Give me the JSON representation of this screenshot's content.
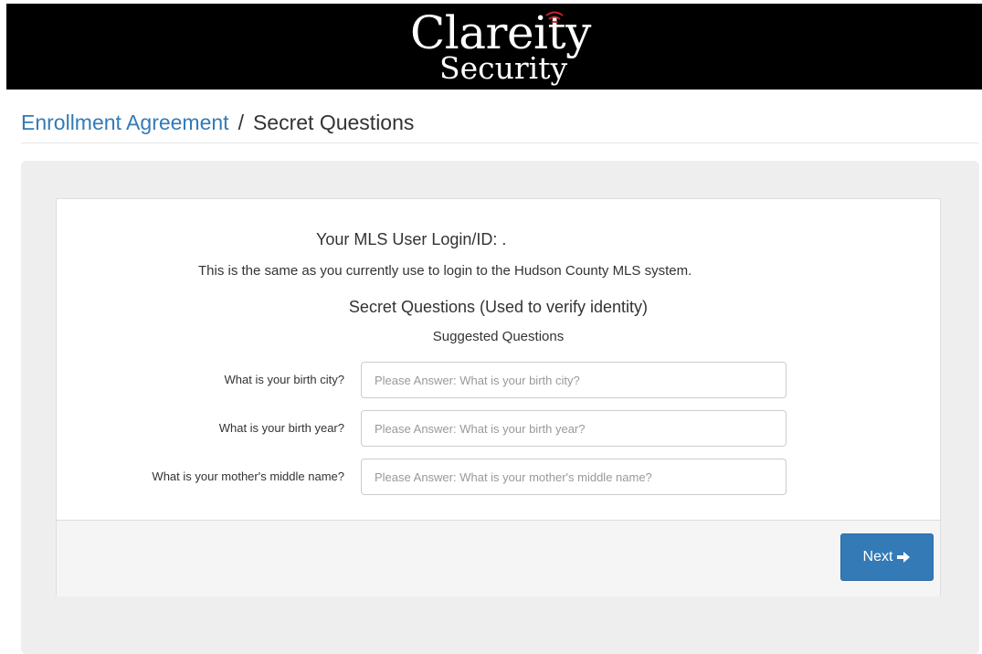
{
  "header": {
    "logo_word1": "Clareity",
    "logo_word2": "Security",
    "logo_accent_color": "#c0262d"
  },
  "breadcrumb": {
    "link": "Enrollment Agreement",
    "separator": "/",
    "current": "Secret Questions"
  },
  "form": {
    "login_label": "Your MLS User Login/ID: .",
    "login_note": "This is the same as you currently use to login to the Hudson County MLS system.",
    "section_title": "Secret Questions (Used to verify identity)",
    "section_subtitle": "Suggested Questions",
    "questions": [
      {
        "label": "What is your birth city?",
        "value": "",
        "placeholder": "Please Answer: What is your birth city?"
      },
      {
        "label": "What is your birth year?",
        "value": "",
        "placeholder": "Please Answer: What is your birth year?"
      },
      {
        "label": "What is your mother's middle name?",
        "value": "",
        "placeholder": "Please Answer: What is your mother's middle name?"
      }
    ]
  },
  "footer": {
    "next_label": "Next",
    "next_icon": "arrow-right-icon"
  },
  "colors": {
    "link": "#337ab7",
    "primary_button": "#337ab7",
    "header_bg": "#000000",
    "panel_bg": "#eeeeee"
  }
}
